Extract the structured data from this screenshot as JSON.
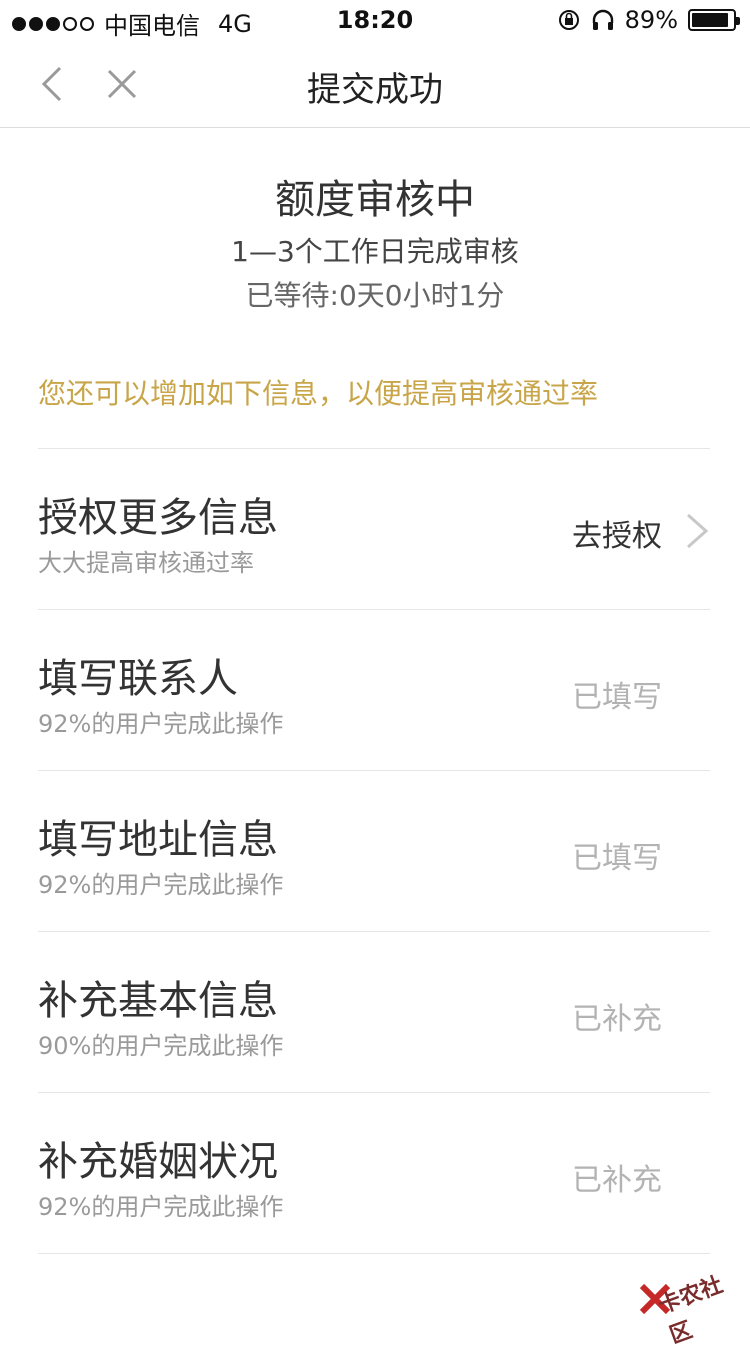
{
  "status_bar": {
    "carrier": "中国电信",
    "network": "4G",
    "time": "18:20",
    "battery": "89%"
  },
  "nav": {
    "title": "提交成功"
  },
  "review": {
    "title": "额度审核中",
    "subtitle": "1—3个工作日完成审核",
    "waited": "已等待:0天0小时1分"
  },
  "hint": "您还可以增加如下信息，以便提高审核通过率",
  "items": [
    {
      "title": "授权更多信息",
      "subtitle": "大大提高审核通过率",
      "action": "去授权"
    },
    {
      "title": "填写联系人",
      "subtitle": "92%的用户完成此操作",
      "action": "已填写"
    },
    {
      "title": "填写地址信息",
      "subtitle": "92%的用户完成此操作",
      "action": "已填写"
    },
    {
      "title": "补充基本信息",
      "subtitle": "90%的用户完成此操作",
      "action": "已补充"
    },
    {
      "title": "补充婚姻状况",
      "subtitle": "92%的用户完成此操作",
      "action": "已补充"
    }
  ],
  "watermark": "卡农社区",
  "colors": {
    "hint": "#c8a548",
    "muted": "#9a9a9a",
    "done": "#b3b3b3"
  }
}
